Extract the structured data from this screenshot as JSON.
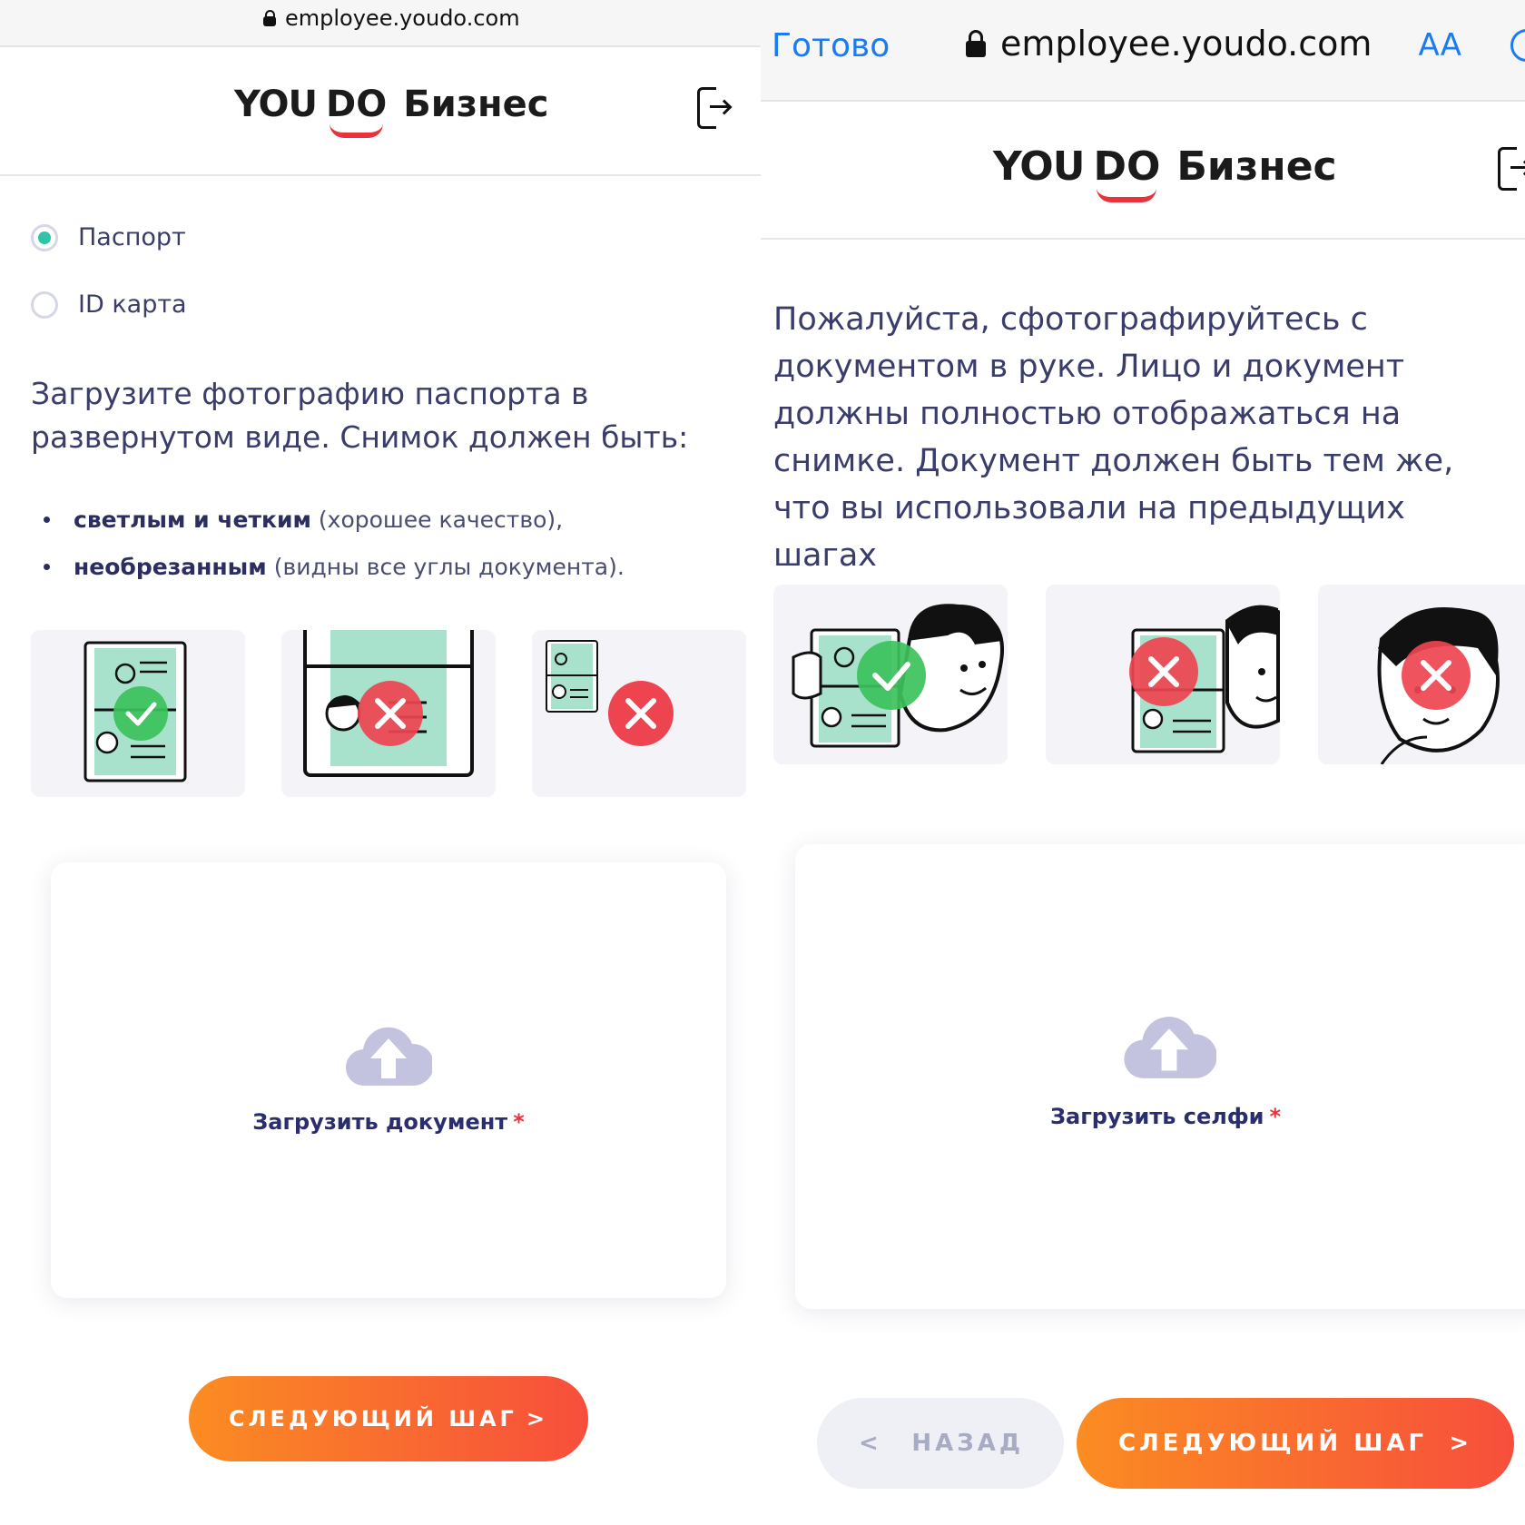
{
  "left": {
    "browser": {
      "url": "employee.youdo.com"
    },
    "logo": {
      "you": "YOU",
      "do": "DO",
      "suffix": "Бизнес"
    },
    "radios": [
      {
        "label": "Паспорт",
        "selected": true
      },
      {
        "label": "ID карта",
        "selected": false
      }
    ],
    "intro": "Загрузите фотографию паспорта в развернутом виде. Снимок должен быть:",
    "bullets": [
      {
        "bold": "светлым и четким",
        "rest": "(хорошее качество),"
      },
      {
        "bold": "необрезанным",
        "rest": "(видны все углы документа)."
      }
    ],
    "examples": [
      "ok",
      "error",
      "error"
    ],
    "upload": {
      "label": "Загрузить документ",
      "required_mark": "*"
    },
    "next_button": {
      "label": "СЛЕДУЮЩИЙ ШАГ",
      "arrow": ">"
    }
  },
  "right": {
    "browser": {
      "done_label": "Готово",
      "url": "employee.youdo.com",
      "text_size_label": "AA"
    },
    "logo": {
      "you": "YOU",
      "do": "DO",
      "suffix": "Бизнес"
    },
    "intro": "Пожалуйста, сфотографируйтесь с документом в руке. Лицо и документ должны полностью отображаться на снимке. Документ должен быть тем же, что вы использовали на предыдущих шагах",
    "examples": [
      "ok",
      "error",
      "error"
    ],
    "upload": {
      "label": "Загрузить селфи",
      "required_mark": "*"
    },
    "back_button": {
      "label": "НАЗАД",
      "arrow": "<"
    },
    "next_button": {
      "label": "СЛЕДУЮЩИЙ ШАГ",
      "arrow": ">"
    }
  },
  "colors": {
    "accent_green": "#2ec4a6",
    "brand_red": "#e8323c",
    "ok": "#3cc25c",
    "error": "#ee4450",
    "button_start": "#fb8c22",
    "button_end": "#f74e3c"
  }
}
